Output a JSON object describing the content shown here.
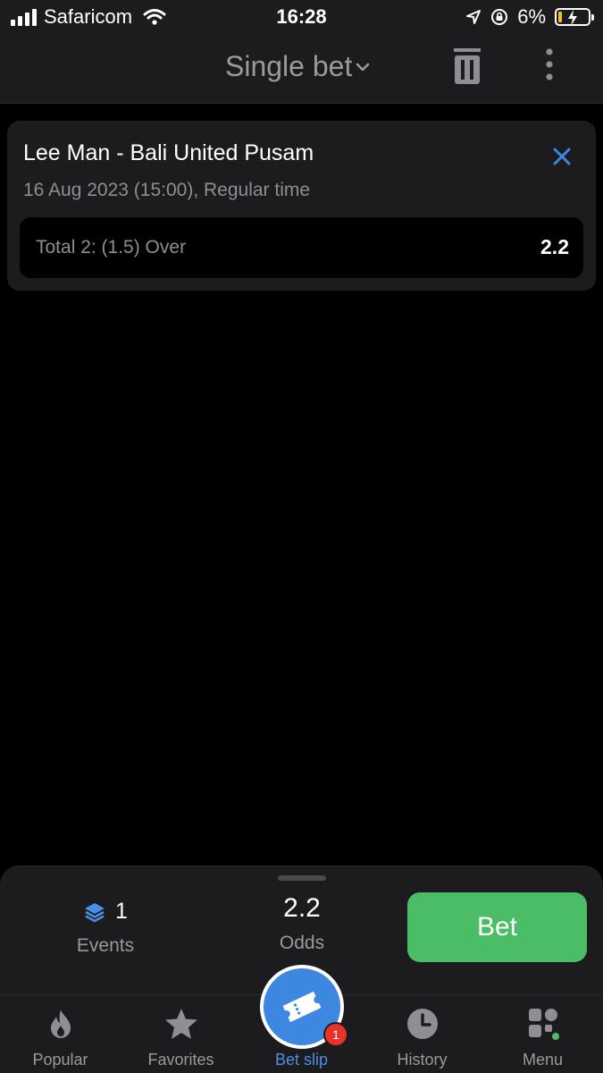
{
  "status_bar": {
    "carrier": "Safaricom",
    "time": "16:28",
    "battery_percent": "6%",
    "battery_level": 0.06
  },
  "header": {
    "title": "Single bet",
    "icons": [
      "chevron-down-icon",
      "trash-icon",
      "more-vertical-icon"
    ]
  },
  "bet_card": {
    "match": "Lee Man - Bali United Pusam",
    "meta": "16 Aug 2023 (15:00), Regular time",
    "market": "Total 2: (1.5) Over",
    "odds": "2.2"
  },
  "summary": {
    "events_count": "1",
    "events_label": "Events",
    "odds_value": "2.2",
    "odds_label": "Odds",
    "bet_label": "Bet"
  },
  "tabs": [
    {
      "label": "Popular",
      "icon": "fire-icon"
    },
    {
      "label": "Favorites",
      "icon": "star-icon"
    },
    {
      "label": "Bet slip",
      "icon": "ticket-icon",
      "badge": "1",
      "active": true
    },
    {
      "label": "History",
      "icon": "clock-icon"
    },
    {
      "label": "Menu",
      "icon": "grid-icon"
    }
  ],
  "colors": {
    "accent_blue": "#3d87e0",
    "bet_green": "#4cbd67",
    "badge_red": "#e8332a",
    "surface": "#1c1c1e"
  }
}
